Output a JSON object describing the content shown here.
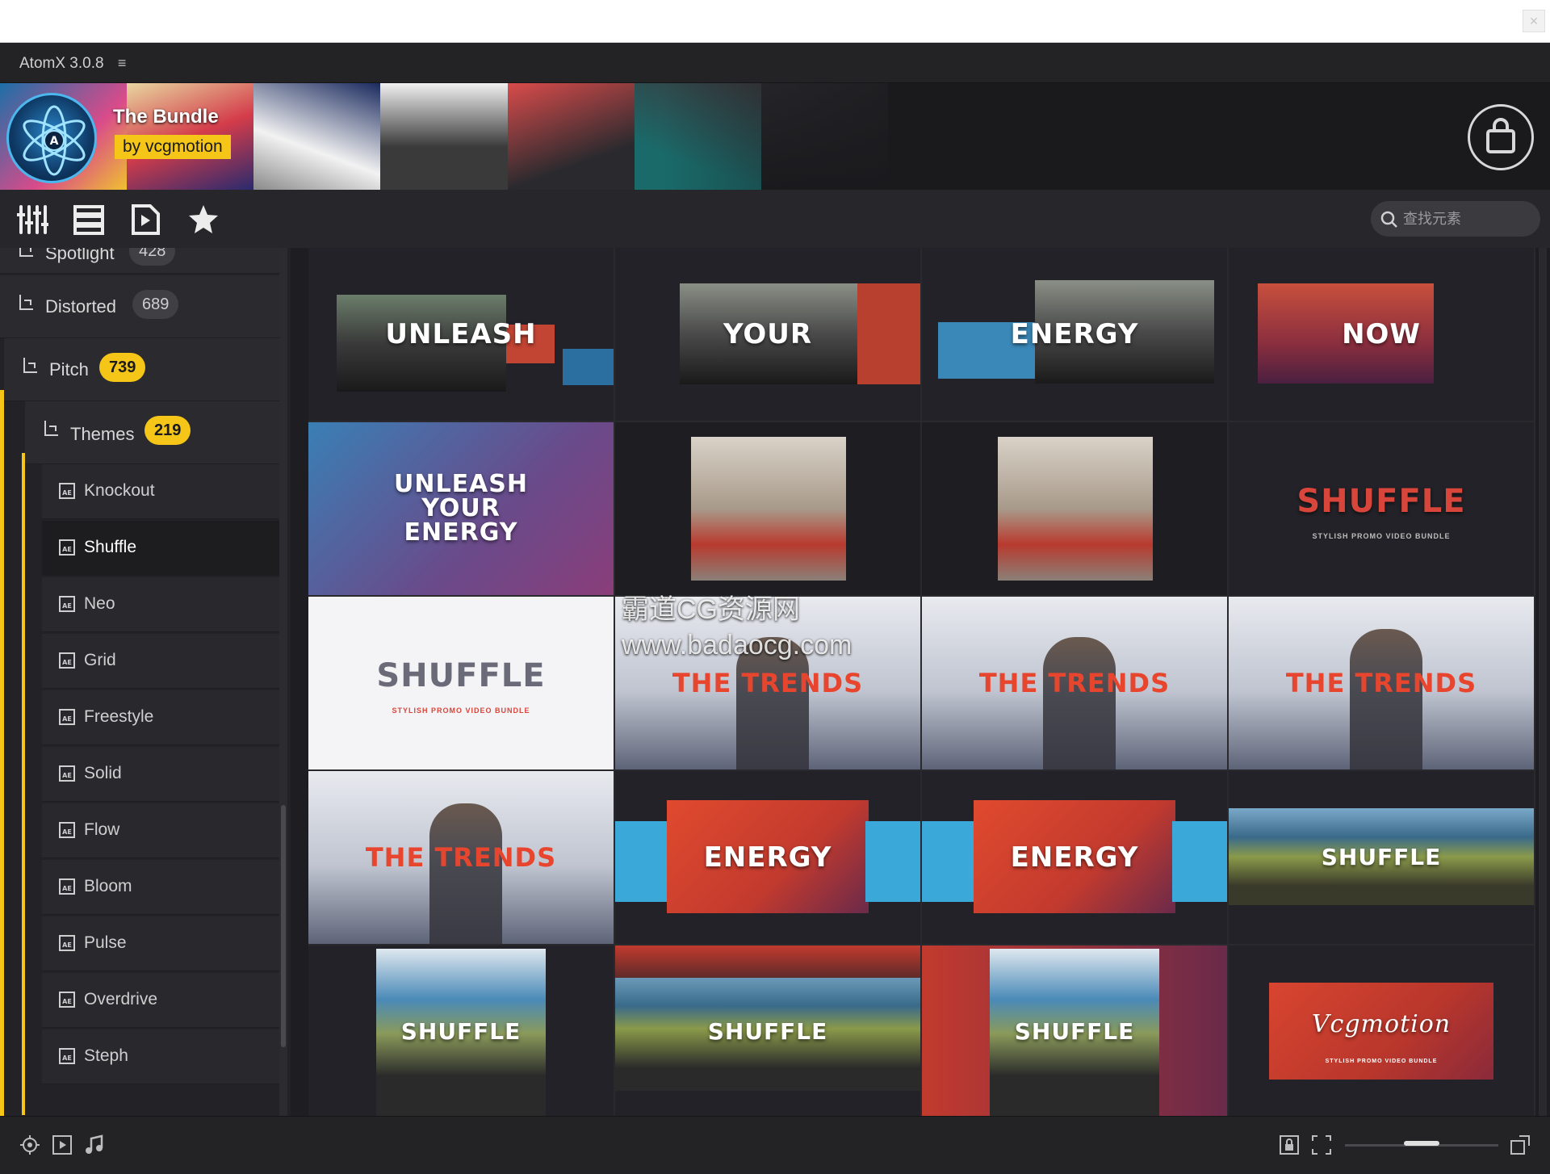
{
  "app": {
    "title": "AtomX 3.0.8",
    "menu_icon": "hamburger-icon"
  },
  "banner": {
    "title": "The Bundle",
    "byline": "by vcgmotion",
    "bag_icon": "shopping-bag-icon"
  },
  "toolbar": {
    "icons": [
      "equalizer-sliders-icon",
      "list-view-icon",
      "play-file-icon",
      "star-icon"
    ],
    "search_placeholder": "查找元素"
  },
  "sidebar": {
    "categories": [
      {
        "label": "Spotlight",
        "count": "428"
      },
      {
        "label": "Distorted",
        "count": "689"
      },
      {
        "label": "Pitch",
        "count": "739"
      },
      {
        "label": "Themes",
        "count": "219"
      }
    ],
    "items": [
      "Knockout",
      "Shuffle",
      "Neo",
      "Grid",
      "Freestyle",
      "Solid",
      "Flow",
      "Bloom",
      "Pulse",
      "Overdrive",
      "Steph"
    ],
    "active_item": "Shuffle",
    "accent": "#f5c518"
  },
  "thumbnails": {
    "t1": "UNLEASH",
    "t2": "YOUR",
    "t3": "ENERGY",
    "t4": "NOW",
    "t5a": "UNLEASH",
    "t5b": "YOUR",
    "t5c": "ENERGY",
    "t8": "SHUFFLE",
    "t8_sub": "STYLISH PROMO VIDEO BUNDLE",
    "t9": "SHUFFLE",
    "t9_sub": "STYLISH PROMO VIDEO BUNDLE",
    "t10": "THE TRENDS",
    "t11": "THE TRENDS",
    "t12": "THE TRENDS",
    "t13": "THE TRENDS",
    "t14": "ENERGY",
    "t15": "ENERGY",
    "t16": "SHUFFLE",
    "t17": "SHUFFLE",
    "t18": "SHUFFLE",
    "t19": "SHUFFLE",
    "t20": "Vcgmotion",
    "t20_sub": "STYLISH PROMO VIDEO BUNDLE"
  },
  "watermark": {
    "line1": "霸道CG资源网",
    "line2": "www.badaocg.com"
  },
  "bottombar": {
    "icons": [
      "locate-icon",
      "video-icon",
      "music-note-icon",
      "lock-icon",
      "fit-screen-icon",
      "expand-icon"
    ],
    "zoom_level": 0.5
  }
}
